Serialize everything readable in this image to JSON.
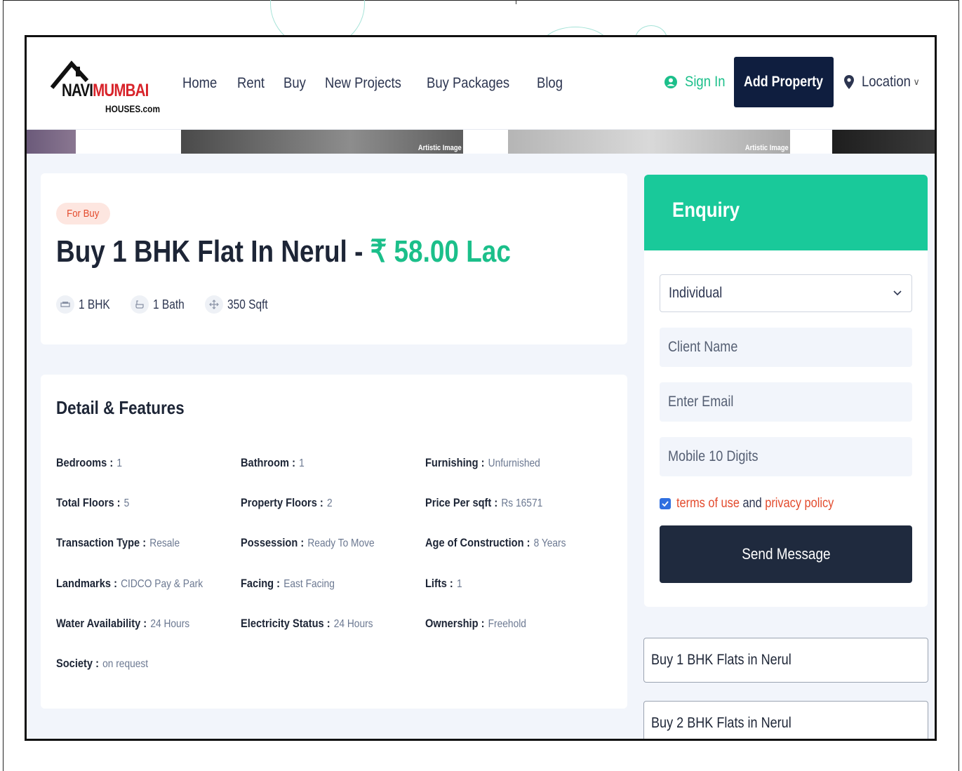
{
  "logo": {
    "navi": "NAVI",
    "mumbai": "MUMBAI",
    "sub": "HOUSES.com"
  },
  "nav": [
    "Home",
    "Rent",
    "Buy",
    "New Projects",
    "Buy Packages",
    "Blog"
  ],
  "header": {
    "signin": "Sign In",
    "add_property": "Add Property",
    "location": "Location"
  },
  "strip": {
    "tag1": "Artistic Image",
    "tag2": "Artistic Image"
  },
  "listing": {
    "pill": "For Buy",
    "title": "Buy 1 BHK Flat In Nerul - ",
    "price": "₹ 58.00 Lac",
    "specs": {
      "bhk": "1 BHK",
      "bath": "1 Bath",
      "area": "350 Sqft"
    }
  },
  "details": {
    "title": "Detail & Features",
    "items": [
      {
        "k": "Bedrooms :",
        "v": "1"
      },
      {
        "k": "Bathroom :",
        "v": "1"
      },
      {
        "k": "Furnishing :",
        "v": "Unfurnished"
      },
      {
        "k": "Total Floors :",
        "v": "5"
      },
      {
        "k": "Property Floors :",
        "v": "2"
      },
      {
        "k": "Price Per sqft :",
        "v": "Rs 16571"
      },
      {
        "k": "Transaction Type :",
        "v": "Resale"
      },
      {
        "k": "Possession :",
        "v": "Ready To Move"
      },
      {
        "k": "Age of Construction :",
        "v": "8 Years"
      },
      {
        "k": "Landmarks :",
        "v": "CIDCO Pay & Park"
      },
      {
        "k": "Facing :",
        "v": "East Facing"
      },
      {
        "k": "Lifts :",
        "v": "1"
      },
      {
        "k": "Water Availability :",
        "v": "24 Hours"
      },
      {
        "k": "Electricity Status :",
        "v": "24 Hours"
      },
      {
        "k": "Ownership :",
        "v": "Freehold"
      },
      {
        "k": "Society :",
        "v": "on request"
      }
    ]
  },
  "enquiry": {
    "title": "Enquiry",
    "select_value": "Individual",
    "name_placeholder": "Client Name",
    "email_placeholder": "Enter Email",
    "mobile_placeholder": "Mobile 10 Digits",
    "terms": "terms of use",
    "and": "and",
    "privacy": "privacy policy",
    "send": "Send Message"
  },
  "links": [
    "Buy 1 BHK Flats in Nerul",
    "Buy 2 BHK Flats in Nerul"
  ],
  "colors": {
    "accent": "#19c99a",
    "navy": "#0f1e3f",
    "alert": "#e34b2d"
  }
}
